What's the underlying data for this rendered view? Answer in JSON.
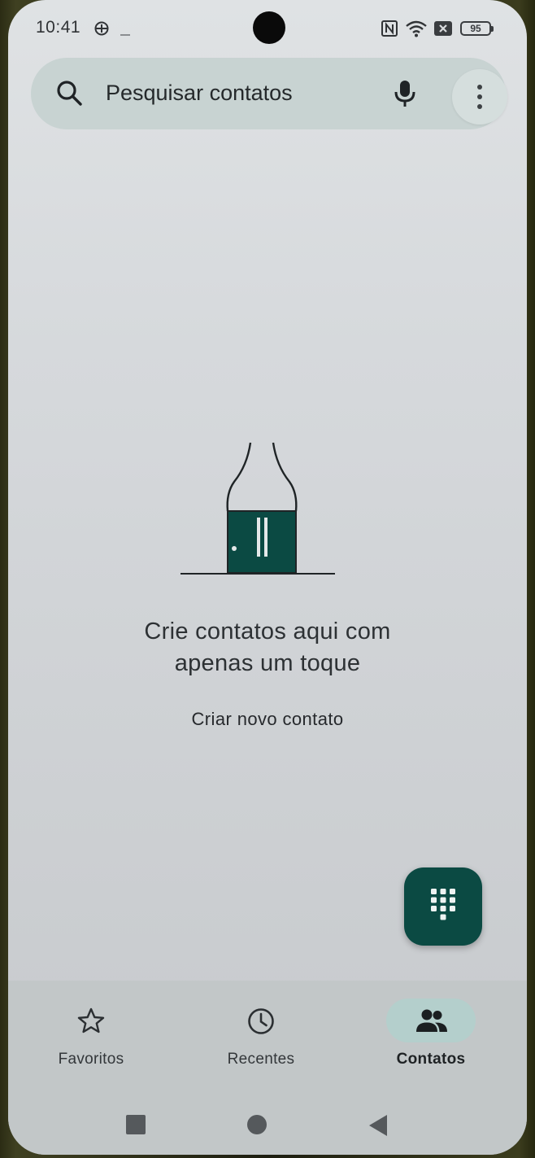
{
  "status_bar": {
    "time": "10:41",
    "battery": "95",
    "icons": [
      "vpn-icon",
      "minus-icon",
      "nfc-icon",
      "wifi-icon",
      "sim-blocked-icon",
      "battery-icon"
    ]
  },
  "search": {
    "placeholder": "Pesquisar contatos",
    "icons": [
      "search-icon",
      "mic-icon",
      "more-vert-icon"
    ]
  },
  "empty_state": {
    "title_line1": "Crie contatos aqui com",
    "title_line2": "apenas um toque",
    "action": "Criar novo contato",
    "illustration": "door-illustration"
  },
  "fab": {
    "icon": "dialpad-icon"
  },
  "bottom_nav": {
    "items": [
      {
        "label": "Favoritos",
        "icon": "star-icon",
        "active": false
      },
      {
        "label": "Recentes",
        "icon": "clock-icon",
        "active": false
      },
      {
        "label": "Contatos",
        "icon": "people-icon",
        "active": true
      }
    ]
  },
  "system_nav": {
    "icons": [
      "recents-square-icon",
      "home-circle-icon",
      "back-triangle-icon"
    ]
  },
  "colors": {
    "accent": "#0b4a43",
    "search_bg": "#c8d3d2",
    "active_pill": "#b4cfcc",
    "background": "#d6d9dc"
  }
}
